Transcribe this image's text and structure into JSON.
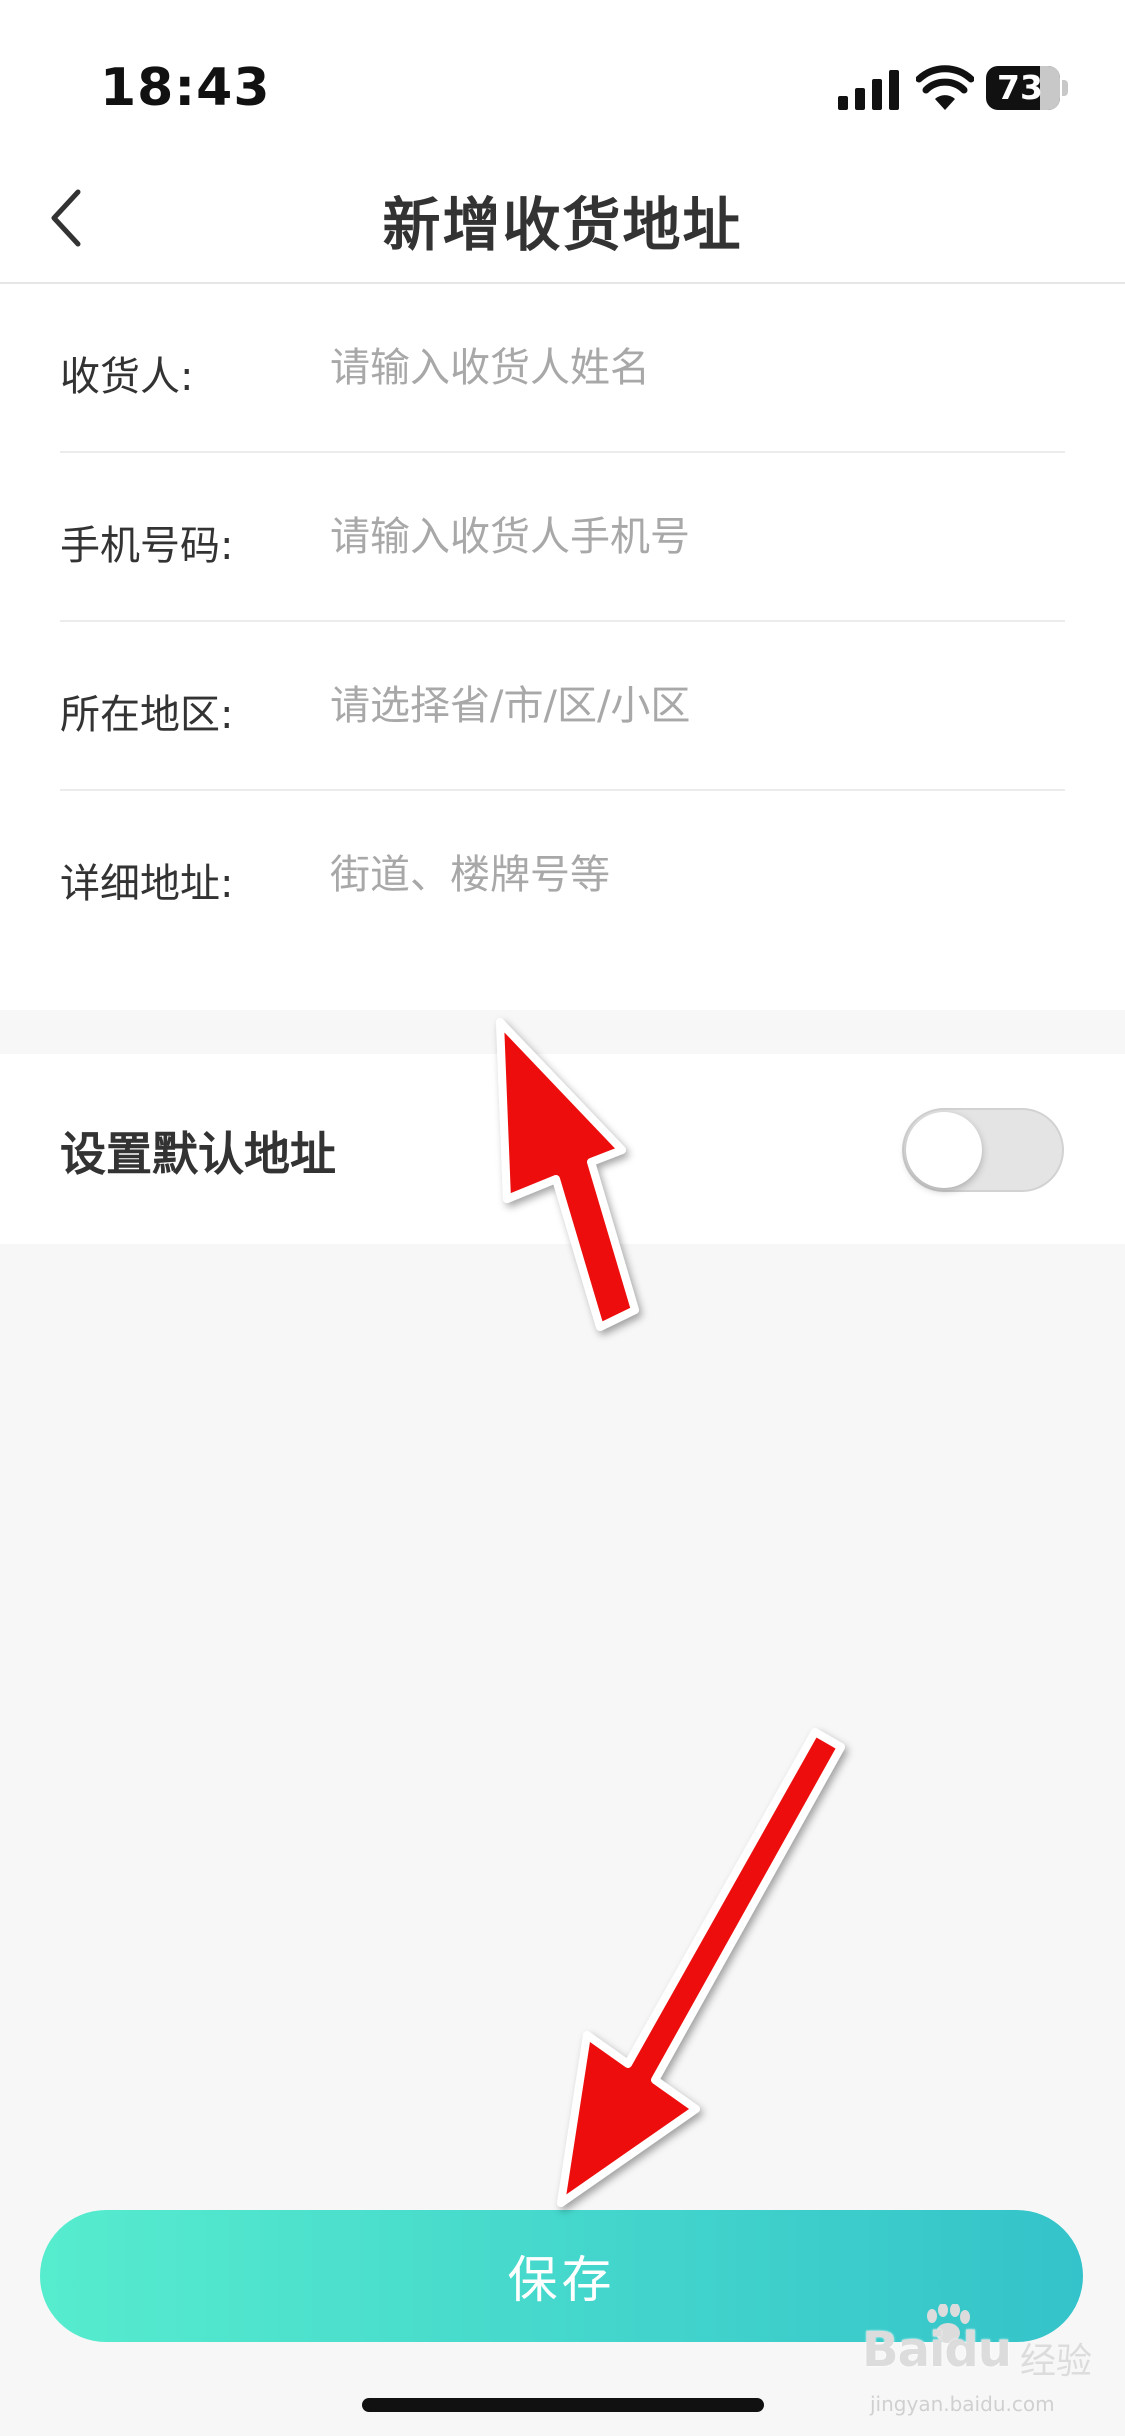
{
  "status_bar": {
    "time": "18:43",
    "battery_level": "73",
    "battery_percent": 73
  },
  "nav": {
    "title": "新增收货地址",
    "back_icon": "chevron-left-icon"
  },
  "form": {
    "rows": [
      {
        "label": "收货人:",
        "placeholder": "请输入收货人姓名",
        "value": ""
      },
      {
        "label": "手机号码:",
        "placeholder": "请输入收货人手机号",
        "value": ""
      },
      {
        "label": "所在地区:",
        "placeholder": "请选择省/市/区/小区",
        "value": ""
      },
      {
        "label": "详细地址:",
        "placeholder": "街道、楼牌号等",
        "value": ""
      }
    ]
  },
  "default_address": {
    "label": "设置默认地址",
    "enabled": false
  },
  "save": {
    "label": "保存"
  },
  "watermark": {
    "logo": "Baidu",
    "cn": "经验",
    "url": "jingyan.baidu.com"
  },
  "colors": {
    "accent_start": "#56ecce",
    "accent_end": "#34c3ca",
    "annotation_arrow": "#ee1111",
    "page_background": "#f7f7f7"
  }
}
